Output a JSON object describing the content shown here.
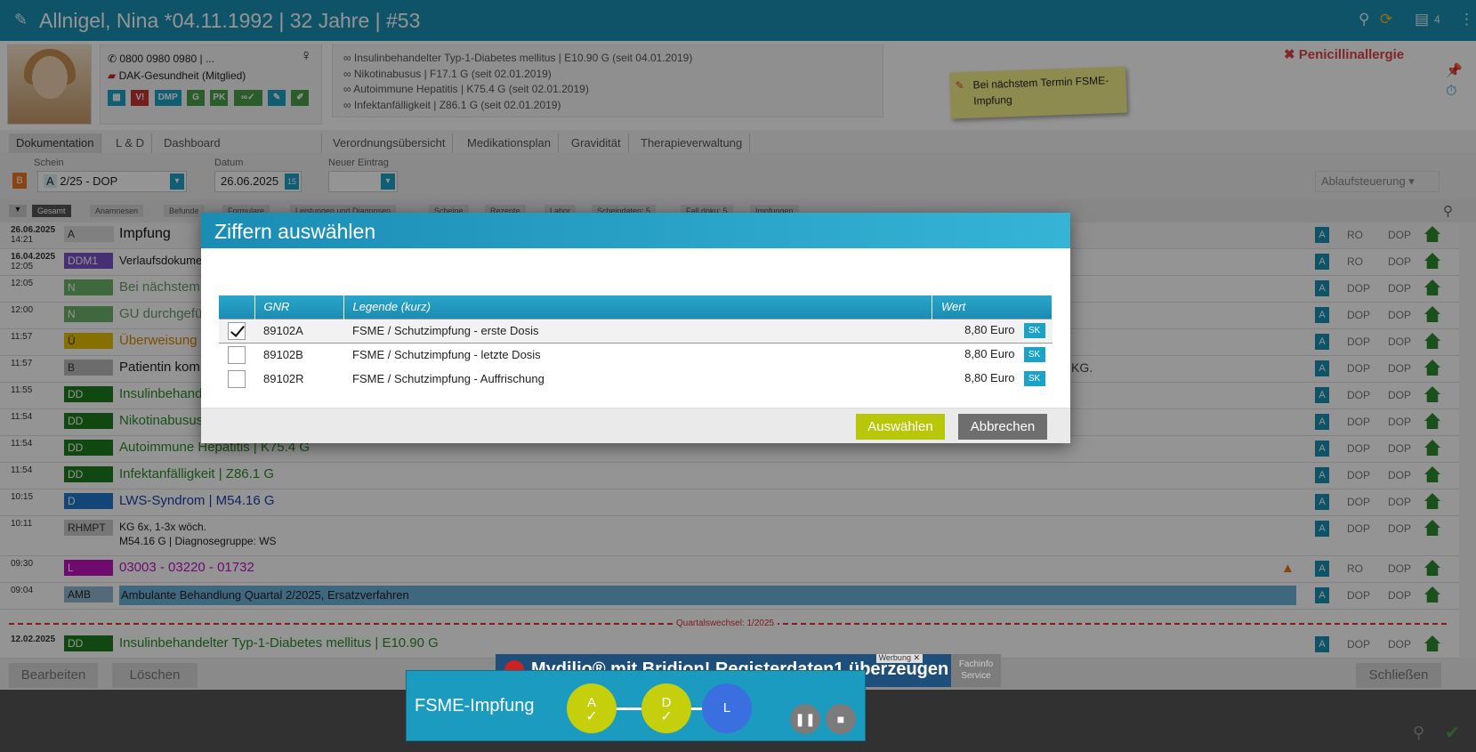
{
  "titlebar": {
    "title": "Allnigel, Nina *04.11.1992 | 32 Jahre | #53",
    "count": "4"
  },
  "patient": {
    "phone": "0800 0980 0980 | ...",
    "insurance": "DAK-Gesundheit (Mitglied)",
    "badges": [
      "V!",
      "DMP",
      "G",
      "PK"
    ],
    "diagnoses": [
      "Insulinbehandelter Typ-1-Diabetes mellitus | E10.90 G (seit 04.01.2019)",
      "Nikotinabusus | F17.1 G (seit 02.01.2019)",
      "Autoimmune Hepatitis | K75.4 G (seit 02.01.2019)",
      "Infektanfälligkeit | Z86.1 G (seit 02.01.2019)"
    ],
    "allergy": "Penicillinallergie",
    "sticky": "Bei nächstem Termin FSME-Impfung"
  },
  "tabs": [
    "Dokumentation",
    "L & D",
    "Dashboard",
    "Verordnungsübersicht",
    "Medikationsplan",
    "Gravidität",
    "Therapieverwaltung"
  ],
  "filters": {
    "schein_label": "Schein",
    "schein_value": "2/25 - DOP",
    "datum_label": "Datum",
    "datum_value": "26.06.2025",
    "neuer_label": "Neuer Eintrag",
    "ablauf": "Ablaufsteuerung"
  },
  "chips": [
    "Gesamt",
    "Anamnesen",
    "Befunde",
    "Formulare",
    "Leistungen und Diagnosen",
    "Scheine",
    "Rezepte",
    "Labor",
    "Scheindaten: 5",
    "Fall doku: 5",
    "Impfungen"
  ],
  "rows": [
    {
      "date": "26.06.2025",
      "time": "14:21",
      "type": "A",
      "text": "Impfung",
      "c1": "RO",
      "c2": "DOP"
    },
    {
      "date": "16.04.2025",
      "time": "12:05",
      "type": "DDM1",
      "text": "Verlaufsdokume",
      "c1": "RO",
      "c2": "DOP"
    },
    {
      "date": "",
      "time": "12:05",
      "type": "N",
      "text": "Bei nächstem",
      "c1": "DOP",
      "c2": "DOP"
    },
    {
      "date": "",
      "time": "12:00",
      "type": "N",
      "text": "GU durchgefü",
      "c1": "DOP",
      "c2": "DOP"
    },
    {
      "date": "",
      "time": "11:57",
      "type": "Ü",
      "text": "Überweisung",
      "c1": "DOP",
      "c2": "DOP"
    },
    {
      "date": "",
      "time": "11:57",
      "type": "B",
      "text": "Patientin kom",
      "c1": "DOP",
      "c2": "DOP"
    },
    {
      "date": "",
      "time": "11:55",
      "type": "DD",
      "text": "Insulinbehand",
      "c1": "DOP",
      "c2": "DOP"
    },
    {
      "date": "",
      "time": "11:54",
      "type": "DD",
      "text": "Nikotinabusus",
      "c1": "DOP",
      "c2": "DOP"
    },
    {
      "date": "",
      "time": "11:54",
      "type": "DD",
      "text": "Autoimmune Hepatitis |  K75.4 G",
      "c1": "DOP",
      "c2": "DOP"
    },
    {
      "date": "",
      "time": "11:54",
      "type": "DD",
      "text": "Infektanfälligkeit |  Z86.1 G",
      "c1": "DOP",
      "c2": "DOP"
    },
    {
      "date": "",
      "time": "10:15",
      "type": "D",
      "text": "LWS-Syndrom |  M54.16 G",
      "c1": "DOP",
      "c2": "DOP"
    },
    {
      "date": "",
      "time": "10:11",
      "type": "RHMPT",
      "text": "KG 6x, 1-3x wöch.",
      "text2": "M54.16 G | Diagnosegruppe: WS",
      "c1": "DOP",
      "c2": "DOP"
    },
    {
      "date": "",
      "time": "09:30",
      "type": "L",
      "text": "03003 - 03220 - 01732",
      "c1": "RO",
      "c2": "DOP"
    },
    {
      "date": "",
      "time": "09:04",
      "type": "AMB",
      "text": "Ambulante Behandlung Quartal 2/2025, Ersatzverfahren",
      "c1": "DOP",
      "c2": "DOP"
    },
    {
      "date": "12.02.2025",
      "time": "",
      "type": "DD",
      "text": "Insulinbehandelter Typ-1-Diabetes mellitus |  E10.90 G",
      "c1": "DOP",
      "c2": "DOP"
    }
  ],
  "quarter_sep": "Quartalswechsel: 1/2025",
  "row_extra": "KG.",
  "bottom": {
    "edit": "Bearbeiten",
    "delete": "Löschen",
    "close": "Schließen"
  },
  "dialog": {
    "title": "Ziffern auswählen",
    "headers": [
      "GNR",
      "Legende (kurz)",
      "Wert"
    ],
    "items": [
      {
        "gnr": "89102A",
        "legend": "FSME / Schutzimpfung - erste Dosis",
        "value": "8,80 Euro",
        "tag": "SK",
        "checked": true
      },
      {
        "gnr": "89102B",
        "legend": "FSME / Schutzimpfung - letzte Dosis",
        "value": "8,80 Euro",
        "tag": "SK",
        "checked": false
      },
      {
        "gnr": "89102R",
        "legend": "FSME / Schutzimpfung - Auffrischung",
        "value": "8,80 Euro",
        "tag": "SK",
        "checked": false
      }
    ],
    "ok": "Auswählen",
    "cancel": "Abbrechen"
  },
  "workflow": {
    "name": "FSME-Impfung",
    "steps": [
      {
        "label": "A",
        "color": "#c5cf0c",
        "done": true
      },
      {
        "label": "D",
        "color": "#c5cf0c",
        "done": true
      },
      {
        "label": "L",
        "color": "#3a6fe0",
        "done": false
      }
    ]
  },
  "ad": {
    "text": "Mydilio® mit Bridion! Registerdaten1 überzeugen",
    "tag": "Werbung",
    "fachinfo": "Fachinfo Service"
  }
}
